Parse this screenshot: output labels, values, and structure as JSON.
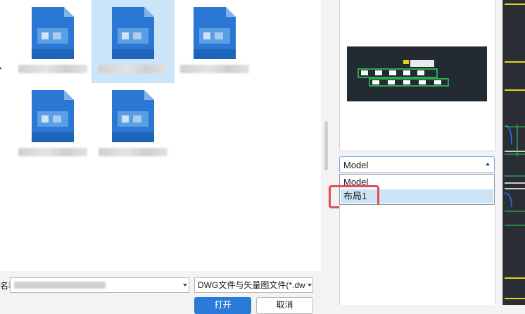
{
  "preview": {
    "title_char": "",
    "layout_select": {
      "value": "Model",
      "options": [
        "Model",
        "布局1"
      ]
    }
  },
  "bottom": {
    "filename_label": "名称:",
    "file_type": "DWG文件与矢量图文件(*.dw",
    "open_label": "打开",
    "cancel_label": "取消"
  },
  "colors": {
    "accent": "#2a7bd8",
    "highlight": "#e84b5c",
    "cad_bg": "#232a32"
  }
}
